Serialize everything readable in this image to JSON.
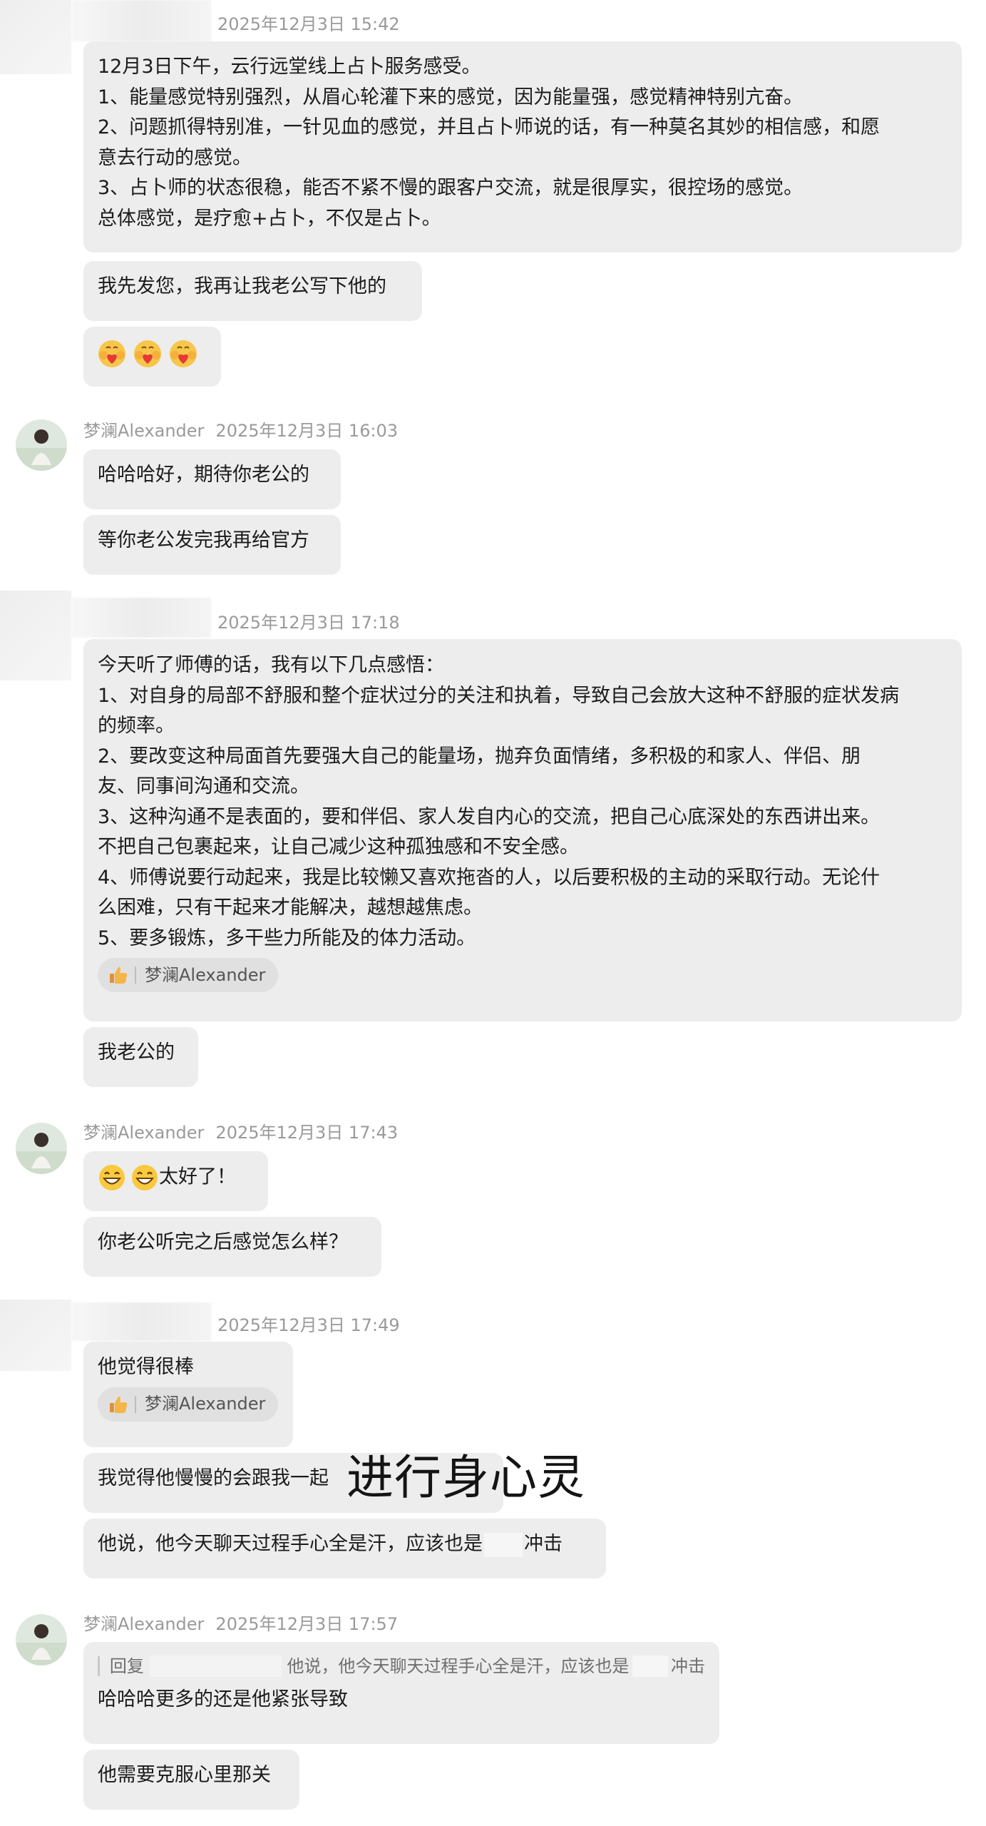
{
  "messages": {
    "m1": {
      "timestamp": "2025年12月3日 15:42",
      "lines": [
        "12月3日下午，云行远堂线上占卜服务感受。",
        "1、能量感觉特别强烈，从眉心轮灌下来的感觉，因为能量强，感觉精神特别亢奋。",
        "2、问题抓得特别准，一针见血的感觉，并且占卜师说的话，有一种莫名其妙的相信感，和愿",
        "意去行动的感觉。",
        "3、占卜师的状态很稳，能否不紧不慢的跟客户交流，就是很厚实，很控场的感觉。",
        "总体感觉，是疗愈+占卜，不仅是占卜。"
      ]
    },
    "m2": {
      "text": "我先发您，我再让我老公写下他的"
    },
    "m3": {
      "emojis": [
        "heart-hug-emoji",
        "heart-hug-emoji",
        "heart-hug-emoji"
      ]
    },
    "m4": {
      "sender": "梦澜Alexander",
      "timestamp": "2025年12月3日 16:03",
      "bubbles": [
        "哈哈哈好，期待你老公的",
        "等你老公发完我再给官方"
      ]
    },
    "m5": {
      "timestamp": "2025年12月3日 17:18",
      "lines": [
        "今天听了师傅的话，我有以下几点感悟：",
        "1、对自身的局部不舒服和整个症状过分的关注和执着，导致自己会放大这种不舒服的症状发病",
        "的频率。",
        "2、要改变这种局面首先要强大自己的能量场，抛弃负面情绪，多积极的和家人、伴侣、朋",
        "友、同事间沟通和交流。",
        "3、这种沟通不是表面的，要和伴侣、家人发自内心的交流，把自己心底深处的东西讲出来。",
        "不把自己包裹起来，让自己减少这种孤独感和不安全感。",
        "4、师傅说要行动起来，我是比较懒又喜欢拖沓的人，以后要积极的主动的采取行动。无论什",
        "么困难，只有干起来才能解决，越想越焦虑。",
        "5、要多锻炼，多干些力所能及的体力活动。"
      ],
      "reaction_name": "梦澜Alexander"
    },
    "m6": {
      "text": "我老公的"
    },
    "m7": {
      "sender": "梦澜Alexander",
      "timestamp": "2025年12月3日 17:43",
      "bubble1_text": "太好了！",
      "bubble2_text": "你老公听完之后感觉怎么样？"
    },
    "m8": {
      "timestamp": "2025年12月3日 17:49",
      "bubble1_text": "他觉得很棒",
      "reaction_name": "梦澜Alexander",
      "bubble2_text": "我觉得他慢慢的会跟我一起",
      "overlay_text": "进行身心灵",
      "bubble3_before": "他说，他今天聊天过程手心全是汗，应该也是",
      "bubble3_after": "冲击"
    },
    "m9": {
      "sender": "梦澜Alexander",
      "timestamp": "2025年12月3日 17:57",
      "quote_label": "回复",
      "quote_text_before": "他说，他今天聊天过程手心全是汗，应该也是",
      "quote_text_after": "冲击",
      "reply_text": "哈哈哈更多的还是他紧张导致",
      "bubble2_text": "他需要克服心里那关"
    }
  }
}
